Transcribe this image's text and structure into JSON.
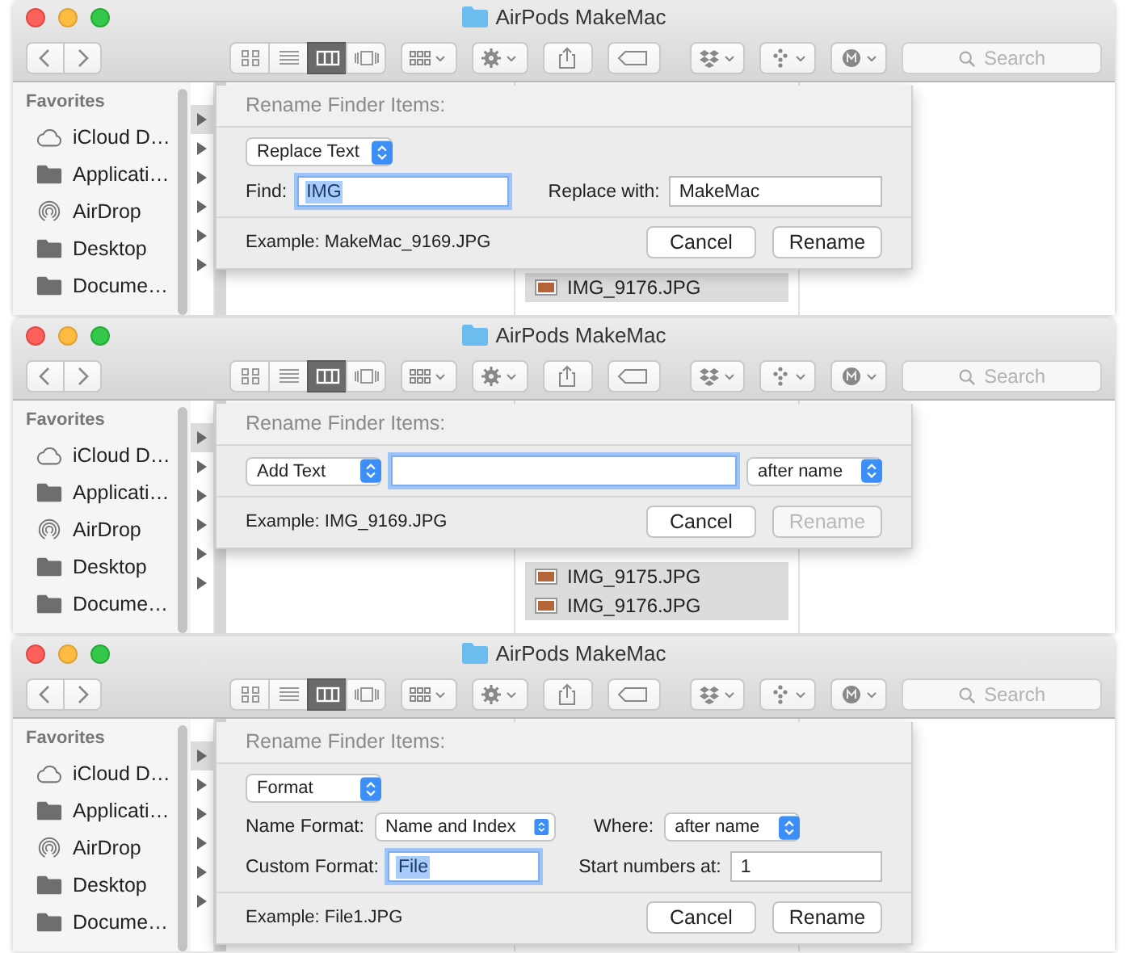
{
  "panels": [
    {
      "window": {
        "title": "AirPods MakeMac"
      },
      "toolbar": {
        "view_buttons": [
          {
            "kind": "icons",
            "selected": false
          },
          {
            "kind": "list",
            "selected": false
          },
          {
            "kind": "columns",
            "selected": true
          },
          {
            "kind": "coverflow",
            "selected": false
          }
        ]
      },
      "search": {
        "placeholder": "Search"
      },
      "sidebar": {
        "heading": "Favorites",
        "items": [
          {
            "kind": "cloud",
            "label": "iCloud D…"
          },
          {
            "kind": "folder",
            "label": "Applicati…"
          },
          {
            "kind": "airdrop",
            "label": "AirDrop"
          },
          {
            "kind": "folder",
            "label": "Desktop"
          },
          {
            "kind": "folder",
            "label": "Docume…"
          }
        ]
      },
      "files": [
        {
          "name": "IMG_9176.JPG",
          "selected": true
        }
      ],
      "dialog": {
        "title": "Rename Finder Items:",
        "rows": [
          {
            "items": [
              {
                "kind": "popup",
                "value": "Replace Text"
              }
            ]
          },
          {
            "items": [
              {
                "kind": "label",
                "text": "Find:"
              },
              {
                "kind": "field",
                "value": "IMG",
                "focused": true,
                "text_selected": true
              },
              {
                "kind": "label",
                "text": "Replace with:"
              },
              {
                "kind": "field",
                "value": "MakeMac",
                "focused": false,
                "text_selected": false
              }
            ]
          }
        ],
        "example": "Example: MakeMac_9169.JPG",
        "buttons": [
          {
            "label": "Cancel",
            "disabled": false
          },
          {
            "label": "Rename",
            "disabled": false
          }
        ]
      }
    },
    {
      "window": {
        "title": "AirPods MakeMac"
      },
      "toolbar": {
        "view_buttons": [
          {
            "kind": "icons",
            "selected": false
          },
          {
            "kind": "list",
            "selected": false
          },
          {
            "kind": "columns",
            "selected": true
          },
          {
            "kind": "coverflow",
            "selected": false
          }
        ]
      },
      "search": {
        "placeholder": "Search"
      },
      "sidebar": {
        "heading": "Favorites",
        "items": [
          {
            "kind": "cloud",
            "label": "iCloud D…"
          },
          {
            "kind": "folder",
            "label": "Applicati…"
          },
          {
            "kind": "airdrop",
            "label": "AirDrop"
          },
          {
            "kind": "folder",
            "label": "Desktop"
          },
          {
            "kind": "folder",
            "label": "Docume…"
          }
        ]
      },
      "files": [
        {
          "name": "IMG_9175.JPG",
          "selected": true
        },
        {
          "name": "IMG_9176.JPG",
          "selected": true
        }
      ],
      "dialog": {
        "title": "Rename Finder Items:",
        "rows": [
          {
            "items": [
              {
                "kind": "popup",
                "value": "Add Text"
              },
              {
                "kind": "field",
                "focused": true
              },
              {
                "kind": "popup",
                "value": "after name"
              }
            ]
          }
        ],
        "example": "Example: IMG_9169.JPG",
        "buttons": [
          {
            "label": "Cancel",
            "disabled": false
          },
          {
            "label": "Rename",
            "disabled": true
          }
        ]
      }
    },
    {
      "window": {
        "title": "AirPods MakeMac"
      },
      "toolbar": {
        "view_buttons": [
          {
            "kind": "icons",
            "selected": false
          },
          {
            "kind": "list",
            "selected": false
          },
          {
            "kind": "columns",
            "selected": true
          },
          {
            "kind": "coverflow",
            "selected": false
          }
        ]
      },
      "search": {
        "placeholder": "Search"
      },
      "sidebar": {
        "heading": "Favorites",
        "items": [
          {
            "kind": "cloud",
            "label": "iCloud D…"
          },
          {
            "kind": "folder",
            "label": "Applicati…"
          },
          {
            "kind": "airdrop",
            "label": "AirDrop"
          },
          {
            "kind": "folder",
            "label": "Desktop"
          },
          {
            "kind": "folder",
            "label": "Docume…"
          }
        ]
      },
      "dialog": {
        "title": "Rename Finder Items:",
        "rows": [
          {
            "items": [
              {
                "kind": "popup",
                "value": "Format"
              }
            ]
          },
          {
            "items": [
              {
                "kind": "label",
                "text": "Name Format:"
              },
              {
                "kind": "popup",
                "value": "Name and Index"
              },
              {
                "kind": "label",
                "text": "Where:"
              },
              {
                "kind": "popup",
                "value": "after name"
              }
            ]
          },
          {
            "items": [
              {
                "kind": "label",
                "text": "Custom Format:"
              },
              {
                "kind": "field",
                "value": "File",
                "focused": true,
                "text_selected": true
              },
              {
                "kind": "label",
                "text": "Start numbers at:"
              },
              {
                "kind": "field",
                "value": "1",
                "focused": false,
                "text_selected": false
              }
            ]
          }
        ],
        "example": "Example: File1.JPG",
        "buttons": [
          {
            "label": "Cancel",
            "disabled": false
          },
          {
            "label": "Rename",
            "disabled": false
          }
        ]
      }
    }
  ]
}
